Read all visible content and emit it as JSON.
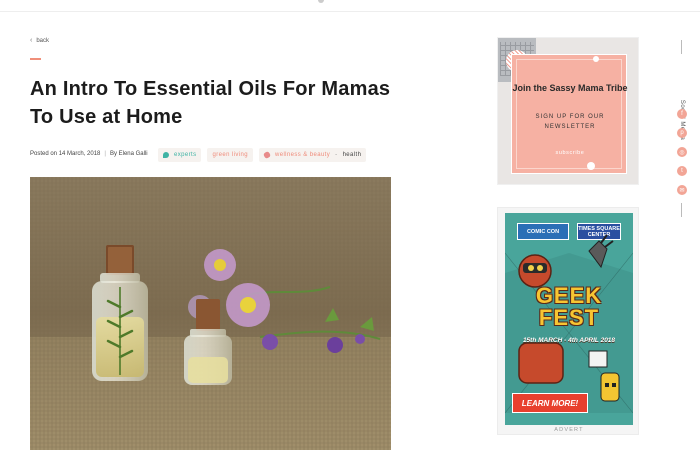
{
  "nav": {
    "back_label": "back"
  },
  "article": {
    "title": "An Intro To Essential Oils For Mamas To Use at Home",
    "posted_label": "Posted on 14 March, 2018",
    "author_label": "By Elena Galli",
    "tags": [
      {
        "label": "experts",
        "icon": "chat-bubble-icon",
        "color": "#3fb3a4"
      },
      {
        "label": "green living",
        "icon": null,
        "color": "#ef8b7a"
      },
      {
        "label": "wellness & beauty",
        "icon": "pill-icon",
        "color": "#ef8b7a"
      },
      {
        "label": "health",
        "icon": null,
        "color": "#444444"
      }
    ],
    "hero_image": "essential-oil-bottles-with-purple-flowers-on-burlap"
  },
  "sidebar": {
    "promo": {
      "title": "Join the Sassy Mama Tribe",
      "subtitle": "SIGN UP FOR OUR NEWSLETTER",
      "button": "subscribe",
      "card_color": "#f6b1a3"
    },
    "social": {
      "label": "Social Media",
      "icons": [
        "facebook-icon",
        "pinterest-icon",
        "instagram-icon",
        "twitter-icon",
        "email-icon"
      ],
      "accent": "#f2a596"
    },
    "ad": {
      "logo_left": "COMIC CON",
      "logo_right": "TIMES SQUARE CENTER",
      "headline": "GEEK FEST",
      "dates": "15th MARCH - 4th APRIL 2018",
      "cta": "LEARN MORE!",
      "footer": "ADVERT"
    }
  }
}
